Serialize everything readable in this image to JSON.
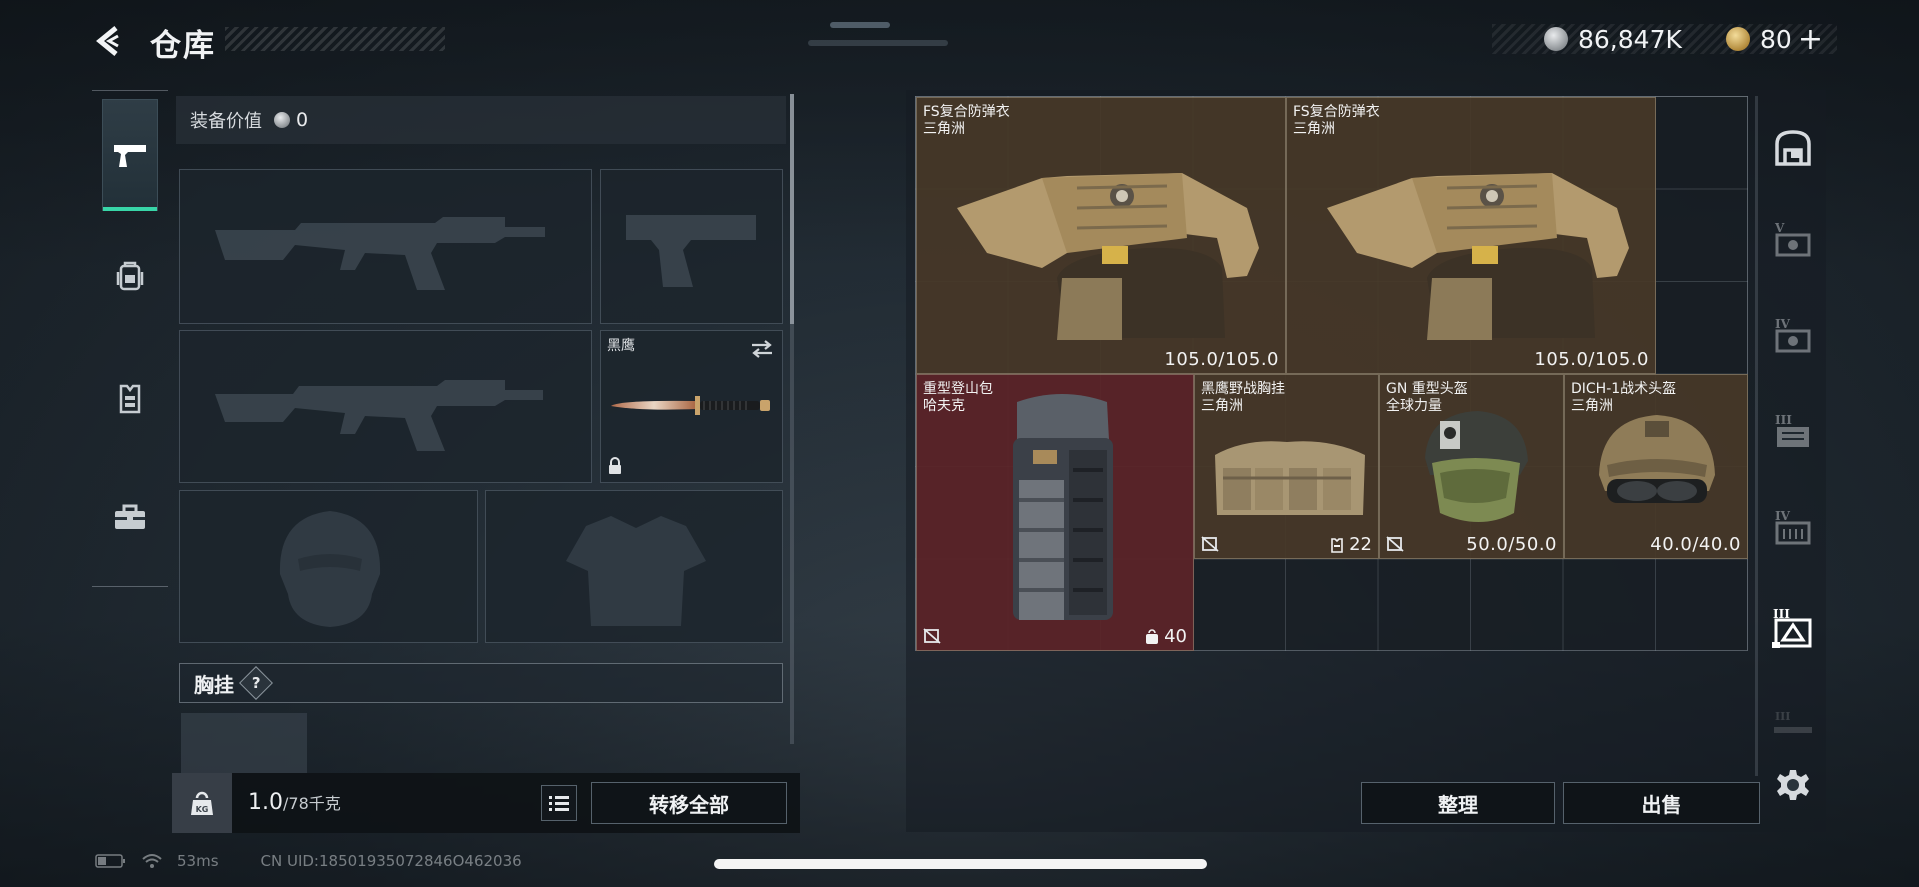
{
  "header": {
    "title": "仓库",
    "currency_silver": "86,847K",
    "currency_gold": "80",
    "gold_plus": "+"
  },
  "left_nav": {
    "items": [
      {
        "name": "pistol-icon",
        "active": true
      },
      {
        "name": "backpack-icon",
        "active": false
      },
      {
        "name": "vest-icon",
        "active": false
      },
      {
        "name": "toolbox-icon",
        "active": false
      }
    ]
  },
  "equipment": {
    "value_label": "装备价值",
    "value_amount": "0",
    "melee_name": "黑鹰",
    "chest_section_title": "胸挂",
    "chest_help": "?"
  },
  "bottom": {
    "kg_label": "KG",
    "weight_current": "1.0",
    "weight_max": "/78千克",
    "transfer_all": "转移全部"
  },
  "storage": {
    "items": [
      {
        "name": "FS复合防弹衣",
        "sub": "三角洲",
        "durability": "105.0/105.0"
      },
      {
        "name": "FS复合防弹衣",
        "sub": "三角洲",
        "durability": "105.0/105.0"
      },
      {
        "name": "重型登山包",
        "sub": "哈夫克",
        "capacity": "40"
      },
      {
        "name": "黑鹰野战胸挂",
        "sub": "三角洲",
        "capacity": "22"
      },
      {
        "name": "GN 重型头盔",
        "sub": "全球力量",
        "durability": "50.0/50.0"
      },
      {
        "name": "DICH-1战术头盔",
        "sub": "三角洲",
        "durability": "40.0/40.0"
      }
    ],
    "sort_button": "整理",
    "sell_button": "出售"
  },
  "right_nav": {
    "items": [
      {
        "name": "vault-icon",
        "state": "normal"
      },
      {
        "name": "tier-v-container-icon",
        "label": "V",
        "state": "dim"
      },
      {
        "name": "tier-iv-container-icon",
        "label": "IV",
        "state": "dim"
      },
      {
        "name": "tier-iii-container-icon",
        "label": "III",
        "state": "dim"
      },
      {
        "name": "tier-iv-storage-icon",
        "label": "IV",
        "state": "dim"
      },
      {
        "name": "tier-iii-armor-icon",
        "label": "III",
        "state": "active"
      },
      {
        "name": "tier-iii-weapon-icon",
        "label": "III",
        "state": "very-dim"
      },
      {
        "name": "settings-icon",
        "state": "normal"
      }
    ]
  },
  "status_bar": {
    "ping": "53ms",
    "uid": "CN UID:18501935072846O462036"
  }
}
